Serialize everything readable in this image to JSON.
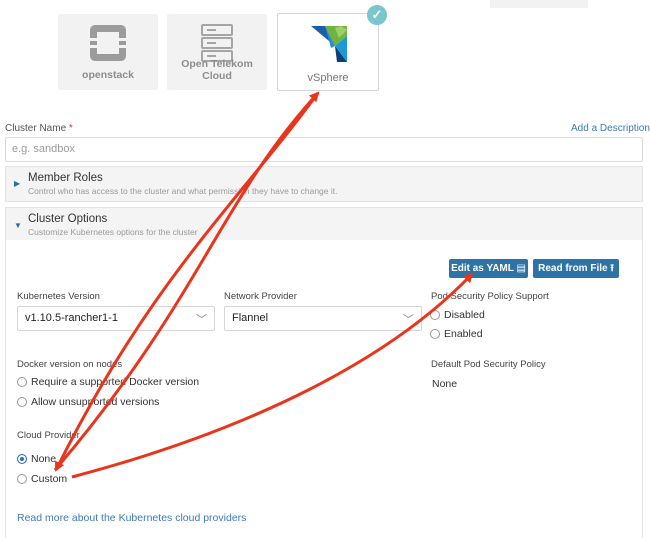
{
  "providers": [
    {
      "label": "openstack",
      "selected": false,
      "icon": "openstack-icon"
    },
    {
      "label": "Open Telekom Cloud",
      "selected": false,
      "icon": "open-telekom-cloud-icon"
    },
    {
      "label": "vSphere",
      "selected": true,
      "icon": "vsphere-icon"
    }
  ],
  "check_glyph": "✓",
  "cluster_name": {
    "label": "Cluster Name",
    "required_mark": "*",
    "placeholder": "e.g. sandbox",
    "add_description": "Add a Description"
  },
  "member_roles": {
    "title": "Member Roles",
    "subtitle": "Control who has access to the cluster and what permission they have to change it."
  },
  "cluster_options": {
    "title": "Cluster Options",
    "subtitle": "Customize Kubernetes options for the cluster"
  },
  "buttons": {
    "edit_yaml": "Edit as YAML",
    "read_file": "Read from File"
  },
  "kubernetes_version": {
    "label": "Kubernetes Version",
    "value": "v1.10.5-rancher1-1"
  },
  "network_provider": {
    "label": "Network Provider",
    "value": "Flannel"
  },
  "psp": {
    "label": "Pod Security Policy Support",
    "options": [
      "Disabled",
      "Enabled"
    ]
  },
  "docker_version": {
    "label": "Docker version on nodes",
    "options": [
      "Require a supported Docker version",
      "Allow unsupported versions"
    ]
  },
  "default_psp": {
    "label": "Default Pod Security Policy",
    "value": "None"
  },
  "cloud_provider": {
    "label": "Cloud Provider",
    "options": [
      "None",
      "Custom"
    ],
    "selected": "None"
  },
  "read_more": {
    "prefix": "Read more about the ",
    "link": "Kubernetes cloud providers"
  },
  "colors": {
    "accent": "#2d73a6",
    "annotation_arrow": "#e8351c",
    "check": "#79c6cd"
  }
}
